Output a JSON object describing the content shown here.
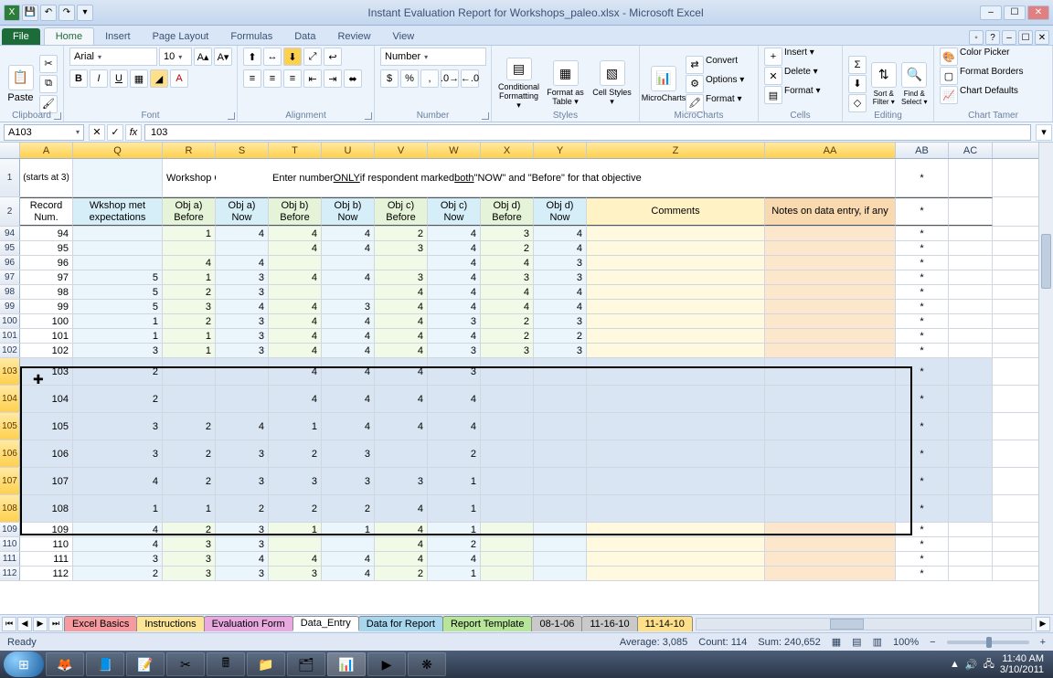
{
  "title": "Instant Evaluation Report for Workshops_paleo.xlsx - Microsoft Excel",
  "qat": {
    "excel": "X",
    "save": "💾",
    "undo": "↶",
    "redo": "↷",
    "dd": "▾"
  },
  "file_tab": "File",
  "tabs": [
    "Home",
    "Insert",
    "Page Layout",
    "Formulas",
    "Data",
    "Review",
    "View"
  ],
  "groups": {
    "clipboard": "Clipboard",
    "font": "Font",
    "alignment": "Alignment",
    "number": "Number",
    "styles": "Styles",
    "microcharts": "MicroCharts",
    "cells": "Cells",
    "editing": "Editing",
    "charttamer": "Chart Tamer"
  },
  "font": {
    "name": "Arial",
    "size": "10",
    "bold": "B",
    "italic": "I",
    "underline": "U"
  },
  "number_format": "Number",
  "styles": {
    "cond": "Conditional Formatting ▾",
    "table": "Format as Table ▾",
    "cell": "Cell Styles ▾"
  },
  "micro": {
    "convert": "Convert",
    "options": "Options ▾",
    "format": "Format ▾",
    "big": "MicroCharts"
  },
  "cells": {
    "insert": "Insert ▾",
    "delete": "Delete ▾",
    "format": "Format ▾"
  },
  "editing": {
    "sort": "Sort & Filter ▾",
    "find": "Find & Select ▾",
    "sum": "Σ",
    "fill": "⬇",
    "clear": "◇"
  },
  "charttamer": {
    "picker": "Color Picker",
    "borders": "Format Borders",
    "defaults": "Chart Defaults"
  },
  "paste_label": "Paste",
  "namebox": "A103",
  "fx_value": "103",
  "columns": [
    "A",
    "Q",
    "R",
    "S",
    "T",
    "U",
    "V",
    "W",
    "X",
    "Y",
    "Z",
    "AA",
    "AB",
    "AC"
  ],
  "row1": {
    "A": "(starts at 3)",
    "R": "Workshop Objectives",
    "T_pre": "Enter number ",
    "T_u1": "ONLY",
    "T_mid": " if respondent marked ",
    "T_u2": "both",
    "T_post": " \"NOW\" and \"Before\" for that objective",
    "AB": "*"
  },
  "row2": {
    "A": "Record Num.",
    "Q": "Wkshop met expectations",
    "R": "Obj a) Before",
    "S": "Obj a) Now",
    "T": "Obj b) Before",
    "U": "Obj b) Now",
    "V": "Obj c) Before",
    "W": "Obj c) Now",
    "X": "Obj d) Before",
    "Y": "Obj d) Now",
    "Z": "Comments",
    "AA": "Notes on data entry, if any",
    "AB": "*"
  },
  "data": [
    {
      "rn": 94,
      "A": 94,
      "Q": "",
      "R": 1,
      "S": 4,
      "T": 4,
      "U": 4,
      "V": 2,
      "W": 4,
      "X": 3,
      "Y": 4,
      "AB": "*"
    },
    {
      "rn": 95,
      "A": 95,
      "Q": "",
      "R": "",
      "S": "",
      "T": 4,
      "U": 4,
      "V": 3,
      "W": 4,
      "X": 2,
      "Y": 4,
      "AB": "*"
    },
    {
      "rn": 96,
      "A": 96,
      "Q": "",
      "R": 4,
      "S": 4,
      "T": "",
      "U": "",
      "V": "",
      "W": 4,
      "X": 4,
      "Y": 3,
      "AB": "*"
    },
    {
      "rn": 97,
      "A": 97,
      "Q": 5,
      "R": 1,
      "S": 3,
      "T": 4,
      "U": 4,
      "V": 3,
      "W": 4,
      "X": 3,
      "Y": 3,
      "AB": "*"
    },
    {
      "rn": 98,
      "A": 98,
      "Q": 5,
      "R": 2,
      "S": 3,
      "T": "",
      "U": "",
      "V": 4,
      "W": 4,
      "X": 4,
      "Y": 4,
      "AB": "*"
    },
    {
      "rn": 99,
      "A": 99,
      "Q": 5,
      "R": 3,
      "S": 4,
      "T": 4,
      "U": 3,
      "V": 4,
      "W": 4,
      "X": 4,
      "Y": 4,
      "AB": "*"
    },
    {
      "rn": 100,
      "A": 100,
      "Q": 1,
      "R": 2,
      "S": 3,
      "T": 4,
      "U": 4,
      "V": 4,
      "W": 3,
      "X": 2,
      "Y": 3,
      "AB": "*"
    },
    {
      "rn": 101,
      "A": 101,
      "Q": 1,
      "R": 1,
      "S": 3,
      "T": 4,
      "U": 4,
      "V": 4,
      "W": 4,
      "X": 2,
      "Y": 2,
      "AB": "*"
    },
    {
      "rn": 102,
      "A": 102,
      "Q": 3,
      "R": 1,
      "S": 3,
      "T": 4,
      "U": 4,
      "V": 4,
      "W": 3,
      "X": 3,
      "Y": 3,
      "AB": "*"
    },
    {
      "rn": 103,
      "A": 103,
      "Q": 2,
      "R": "",
      "S": "",
      "T": 4,
      "U": 4,
      "V": 4,
      "W": 3,
      "X": "",
      "Y": "",
      "AB": "*",
      "sel": true,
      "tall": true
    },
    {
      "rn": 104,
      "A": 104,
      "Q": 2,
      "R": "",
      "S": "",
      "T": 4,
      "U": 4,
      "V": 4,
      "W": 4,
      "X": "",
      "Y": "",
      "AB": "*",
      "sel": true,
      "tall": true
    },
    {
      "rn": 105,
      "A": 105,
      "Q": 3,
      "R": 2,
      "S": 4,
      "T": 1,
      "U": 4,
      "V": 4,
      "W": 4,
      "X": "",
      "Y": "",
      "AB": "*",
      "sel": true,
      "tall": true
    },
    {
      "rn": 106,
      "A": 106,
      "Q": 3,
      "R": 2,
      "S": 3,
      "T": 2,
      "U": 3,
      "V": "",
      "W": 2,
      "X": "",
      "Y": "",
      "AB": "*",
      "sel": true,
      "tall": true
    },
    {
      "rn": 107,
      "A": 107,
      "Q": 4,
      "R": 2,
      "S": 3,
      "T": 3,
      "U": 3,
      "V": 3,
      "W": 1,
      "X": "",
      "Y": "",
      "AB": "*",
      "sel": true,
      "tall": true
    },
    {
      "rn": 108,
      "A": 108,
      "Q": 1,
      "R": 1,
      "S": 2,
      "T": 2,
      "U": 2,
      "V": 4,
      "W": 1,
      "X": "",
      "Y": "",
      "AB": "*",
      "sel": true,
      "tall": true
    },
    {
      "rn": 109,
      "A": 109,
      "Q": 4,
      "R": 2,
      "S": 3,
      "T": 1,
      "U": 1,
      "V": 4,
      "W": 1,
      "X": "",
      "Y": "",
      "AB": "*"
    },
    {
      "rn": 110,
      "A": 110,
      "Q": 4,
      "R": 3,
      "S": 3,
      "T": "",
      "U": "",
      "V": 4,
      "W": 2,
      "X": "",
      "Y": "",
      "AB": "*"
    },
    {
      "rn": 111,
      "A": 111,
      "Q": 3,
      "R": 3,
      "S": 4,
      "T": 4,
      "U": 4,
      "V": 4,
      "W": 4,
      "X": "",
      "Y": "",
      "AB": "*"
    },
    {
      "rn": 112,
      "A": 112,
      "Q": 2,
      "R": 3,
      "S": 3,
      "T": 3,
      "U": 4,
      "V": 2,
      "W": 1,
      "X": "",
      "Y": "",
      "AB": "*"
    }
  ],
  "sheet_tabs": [
    {
      "name": "Excel Basics",
      "color": "#f79aa0"
    },
    {
      "name": "Instructions",
      "color": "#fde597"
    },
    {
      "name": "Evaluation Form",
      "color": "#e7a9e0"
    },
    {
      "name": "Data_Entry",
      "color": "#ffffff",
      "active": true
    },
    {
      "name": "Data for Report",
      "color": "#a7d6ef"
    },
    {
      "name": "Report Template",
      "color": "#b7e59a"
    },
    {
      "name": "08-1-06",
      "color": "#c9c9c9"
    },
    {
      "name": "11-16-10",
      "color": "#c9c9c9"
    },
    {
      "name": "11-14-10",
      "color": "#ffe08a"
    }
  ],
  "tab_nav": {
    "first": "⏮",
    "prev": "◀",
    "next": "▶",
    "last": "⏭"
  },
  "status": {
    "ready": "Ready",
    "avg": "Average: 3,085",
    "count": "Count: 114",
    "sum": "Sum: 240,652",
    "zoom": "100%",
    "minus": "−",
    "plus": "+"
  },
  "tray": {
    "time": "11:40 AM",
    "date": "3/10/2011"
  },
  "help": "?"
}
